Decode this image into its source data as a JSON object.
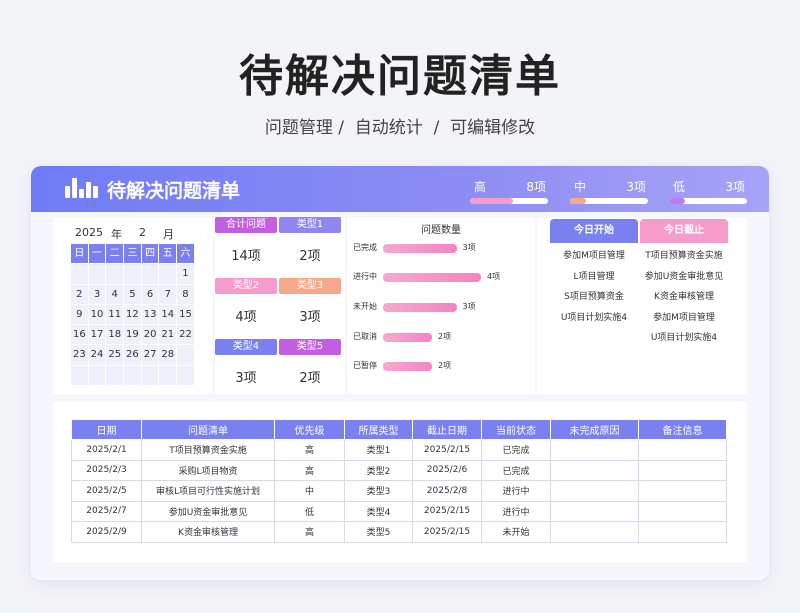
{
  "page": {
    "title": "待解决问题清单",
    "subtitle": "问题管理 /  自动统计  /  可编辑修改"
  },
  "header": {
    "title": "待解决问题清单",
    "priorities": [
      {
        "label": "高",
        "count": "8项",
        "fill": 0.55,
        "color": "#f59ccb"
      },
      {
        "label": "中",
        "count": "3项",
        "fill": 0.2,
        "color": "#f5a98a"
      },
      {
        "label": "低",
        "count": "3项",
        "fill": 0.2,
        "color": "#c07af0"
      }
    ]
  },
  "calendar": {
    "year": "2025",
    "year_unit": "年",
    "month": "2",
    "month_unit": "月",
    "weekdays": [
      "日",
      "一",
      "二",
      "三",
      "四",
      "五",
      "六"
    ],
    "weeks": [
      [
        "",
        "",
        "",
        "",
        "",
        "",
        "1"
      ],
      [
        "2",
        "3",
        "4",
        "5",
        "6",
        "7",
        "8"
      ],
      [
        "9",
        "10",
        "11",
        "12",
        "13",
        "14",
        "15"
      ],
      [
        "16",
        "17",
        "18",
        "19",
        "20",
        "21",
        "22"
      ],
      [
        "23",
        "24",
        "25",
        "26",
        "27",
        "28",
        ""
      ],
      [
        "",
        "",
        "",
        "",
        "",
        "",
        ""
      ]
    ]
  },
  "types": [
    {
      "label": "合计问题",
      "value": "14项",
      "color": "#c45ee0"
    },
    {
      "label": "类型1",
      "value": "2项",
      "color": "#8f86f0"
    },
    {
      "label": "类型2",
      "value": "4项",
      "color": "#f59ccb"
    },
    {
      "label": "类型3",
      "value": "3项",
      "color": "#f5a98a"
    },
    {
      "label": "类型4",
      "value": "3项",
      "color": "#7a80f0"
    },
    {
      "label": "类型5",
      "value": "2项",
      "color": "#c45ee0"
    }
  ],
  "chart_data": {
    "type": "bar",
    "title": "问题数量",
    "categories": [
      "已完成",
      "进行中",
      "未开始",
      "已取消",
      "已暂停"
    ],
    "values": [
      3,
      4,
      3,
      2,
      2
    ],
    "value_labels": [
      "3项",
      "4项",
      "3项",
      "2项",
      "2项"
    ],
    "xlim": [
      0,
      4
    ]
  },
  "today": {
    "start_label": "今日开始",
    "end_label": "今日截止",
    "start_color": "#7a80f0",
    "end_color": "#f59ccb",
    "start_items": [
      "参加M项目管理",
      "L项目管理",
      "S项目预算资金",
      "U项目计划实施4"
    ],
    "end_items": [
      "T项目预算资金实施",
      "参加U资金审批意见",
      "K资金审核管理",
      "参加M项目管理",
      "U项目计划实施4"
    ]
  },
  "table": {
    "columns": [
      "日期",
      "问题清单",
      "优先级",
      "所属类型",
      "截止日期",
      "当前状态",
      "未完成原因",
      "备注信息"
    ],
    "rows": [
      [
        "2025/2/1",
        "T项目预算资金实施",
        "高",
        "类型1",
        "2025/2/15",
        "已完成",
        "",
        ""
      ],
      [
        "2025/2/3",
        "采购L项目物资",
        "高",
        "类型2",
        "2025/2/6",
        "已完成",
        "",
        ""
      ],
      [
        "2025/2/5",
        "审核L项目可行性实施计划",
        "中",
        "类型3",
        "2025/2/8",
        "进行中",
        "",
        ""
      ],
      [
        "2025/2/7",
        "参加U资金审批意见",
        "低",
        "类型4",
        "2025/2/15",
        "进行中",
        "",
        ""
      ],
      [
        "2025/2/9",
        "K资金审核管理",
        "高",
        "类型5",
        "2025/2/15",
        "未开始",
        "",
        ""
      ]
    ]
  }
}
